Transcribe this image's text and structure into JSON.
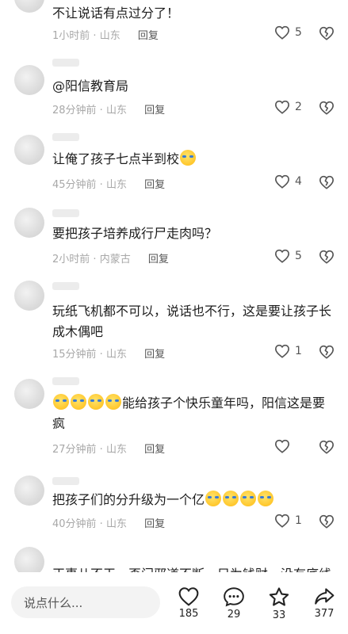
{
  "comments": [
    {
      "text": "不让说话有点过分了！",
      "time": "1小时前",
      "location": "山东",
      "reply": "回复",
      "likes": "5"
    },
    {
      "text": "@阳信教育局",
      "time": "28分钟前",
      "location": "山东",
      "reply": "回复",
      "likes": "2"
    },
    {
      "text": "让俺了孩子七点半到校",
      "time": "45分钟前",
      "location": "山东",
      "reply": "回复",
      "likes": "4"
    },
    {
      "text": "要把孩子培养成行尸走肉吗？",
      "time": "2小时前",
      "location": "内蒙古",
      "reply": "回复",
      "likes": "5"
    },
    {
      "text": "玩纸飞机都不可以，说话也不行，这是要让孩子长成木偶吧",
      "time": "15分钟前",
      "location": "山东",
      "reply": "回复",
      "likes": "1"
    },
    {
      "text": "能给孩子个快乐童年吗，阳信这是要疯",
      "time": "27分钟前",
      "location": "山东",
      "reply": "回复",
      "likes": ""
    },
    {
      "text": "把孩子们的分升级为一个亿",
      "time": "40分钟前",
      "location": "山东",
      "reply": "回复",
      "likes": "1"
    },
    {
      "text": "正事儿不干，歪门邪道不断，只为钱财，没有底线"
    }
  ],
  "separator": " · ",
  "icons": {
    "like": "heart-outline-icon",
    "dislike": "broken-heart-icon"
  },
  "bottom_bar": {
    "input_placeholder": "说点什么...",
    "like_count": "185",
    "comment_count": "29",
    "star_count": "33",
    "share_count": "377"
  }
}
